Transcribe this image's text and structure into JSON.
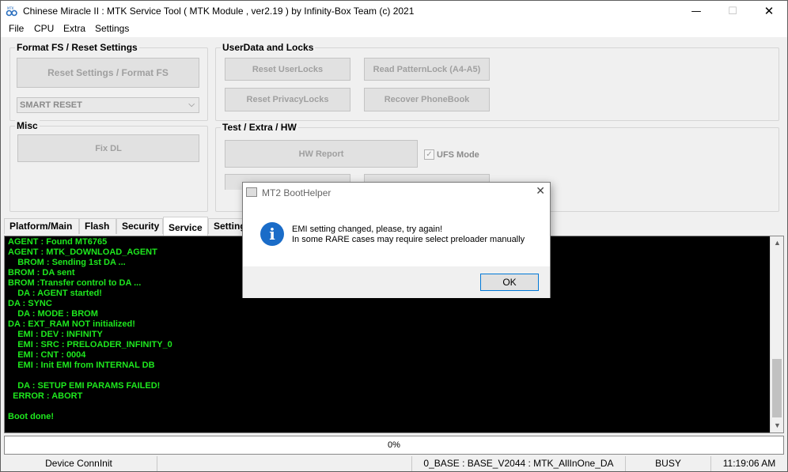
{
  "window": {
    "title": "Chinese Miracle II : MTK Service Tool ( MTK Module , ver2.19  ) by Infinity-Box Team (c) 2021",
    "controls": {
      "minimize": "—",
      "maximize": "☐",
      "close": "✕"
    }
  },
  "menu": [
    "File",
    "CPU",
    "Extra",
    "Settings"
  ],
  "format_group": {
    "title": "Format FS / Reset Settings",
    "button": "Reset Settings / Format FS",
    "combo_value": "SMART RESET"
  },
  "userdata_group": {
    "title": "UserData  and Locks",
    "reset_userlocks": "Reset UserLocks",
    "read_patternlock": "Read PatternLock (A4-A5)",
    "reset_privacylocks": "Reset PrivacyLocks",
    "recover_phonebook": "Recover PhoneBook"
  },
  "misc_group": {
    "title": "Misc",
    "button": "Fix DL"
  },
  "test_group": {
    "title": "Test / Extra / HW",
    "hw_report": "HW Report",
    "ufs_mode_label": "UFS Mode",
    "ufs_mode_checked": true
  },
  "tabs": [
    "Platform/Main",
    "Flash",
    "Security",
    "Service",
    "Settings"
  ],
  "active_tab": "Service",
  "log": [
    "AGENT : Found MT6765",
    "AGENT : MTK_DOWNLOAD_AGENT",
    "    BROM : Sending 1st DA ...",
    "BROM : DA sent",
    "BROM :Transfer control to DA ...",
    "    DA : AGENT started!",
    "DA : SYNC",
    "    DA : MODE : BROM",
    "DA : EXT_RAM NOT initialized!",
    "    EMI : DEV : INFINITY",
    "    EMI : SRC : PRELOADER_INFINITY_0",
    "    EMI : CNT : 0004",
    "    EMI : Init EMI from INTERNAL DB",
    "",
    "    DA : SETUP EMI PARAMS FAILED!",
    "  ERROR : ABORT",
    "",
    "Boot done!"
  ],
  "log_color": "#1ee81e",
  "progress": {
    "percent": 0,
    "label": "0%"
  },
  "status": {
    "connection": "Device ConnInit",
    "base": "0_BASE : BASE_V2044 : MTK_AllInOne_DA",
    "state": "BUSY",
    "time": "11:19:06 AM"
  },
  "dialog": {
    "title": "MT2 BootHelper",
    "close": "✕",
    "icon": "info-icon",
    "line1": "EMI setting changed, please, try again!",
    "line2": "In some RARE cases may require select preloader manually",
    "ok": "OK"
  }
}
